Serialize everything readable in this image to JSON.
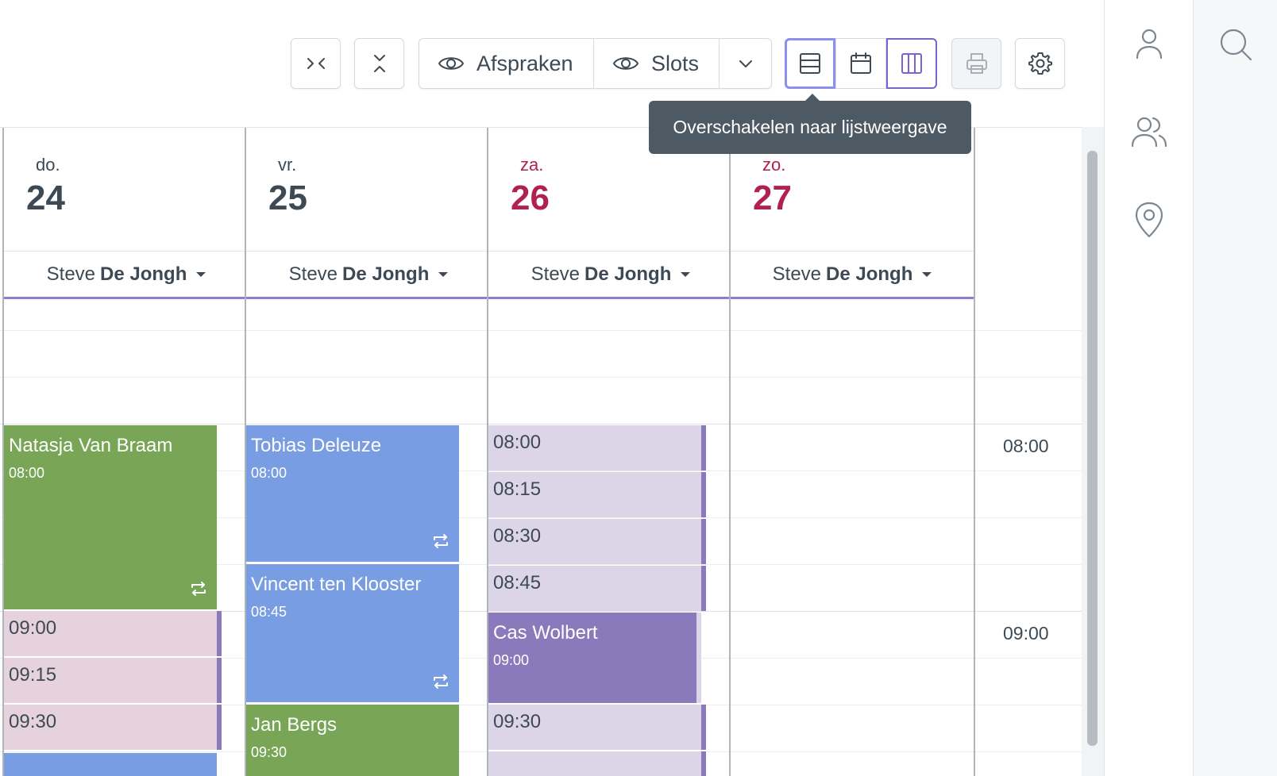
{
  "toolbar": {
    "collapse_horizontal_icon": "collapse-horizontal-icon",
    "collapse_vertical_icon": "collapse-vertical-icon",
    "appointments_label": "Afspraken",
    "slots_label": "Slots",
    "tooltip": "Overschakelen naar lijstweergave"
  },
  "days": [
    {
      "name": "do.",
      "number": "24",
      "weekend": false,
      "resource_first": "Steve",
      "resource_last": "De Jongh"
    },
    {
      "name": "vr.",
      "number": "25",
      "weekend": false,
      "resource_first": "Steve",
      "resource_last": "De Jongh"
    },
    {
      "name": "za.",
      "number": "26",
      "weekend": true,
      "resource_first": "Steve",
      "resource_last": "De Jongh"
    },
    {
      "name": "zo.",
      "number": "27",
      "weekend": true,
      "resource_first": "Steve",
      "resource_last": "De Jongh"
    }
  ],
  "appointments": {
    "natasja": {
      "name": "Natasja Van Braam",
      "time": "08:00"
    },
    "tobias": {
      "name": "Tobias Deleuze",
      "time": "08:00"
    },
    "vincent": {
      "name": "Vincent ten Klooster",
      "time": "08:45"
    },
    "jan": {
      "name": "Jan Bergs",
      "time": "09:30"
    },
    "cas": {
      "name": "Cas Wolbert",
      "time": "09:00"
    }
  },
  "slots": {
    "d24": [
      "09:00",
      "09:15",
      "09:30"
    ],
    "d26": [
      "08:00",
      "08:15",
      "08:30",
      "08:45",
      "09:30"
    ]
  },
  "time_labels": [
    "08:00",
    "09:00"
  ],
  "colors": {
    "accent": "#7b63c9",
    "weekend": "#b0214f",
    "green": "#79a556",
    "blue": "#789de2",
    "purple": "#8b7abb"
  }
}
